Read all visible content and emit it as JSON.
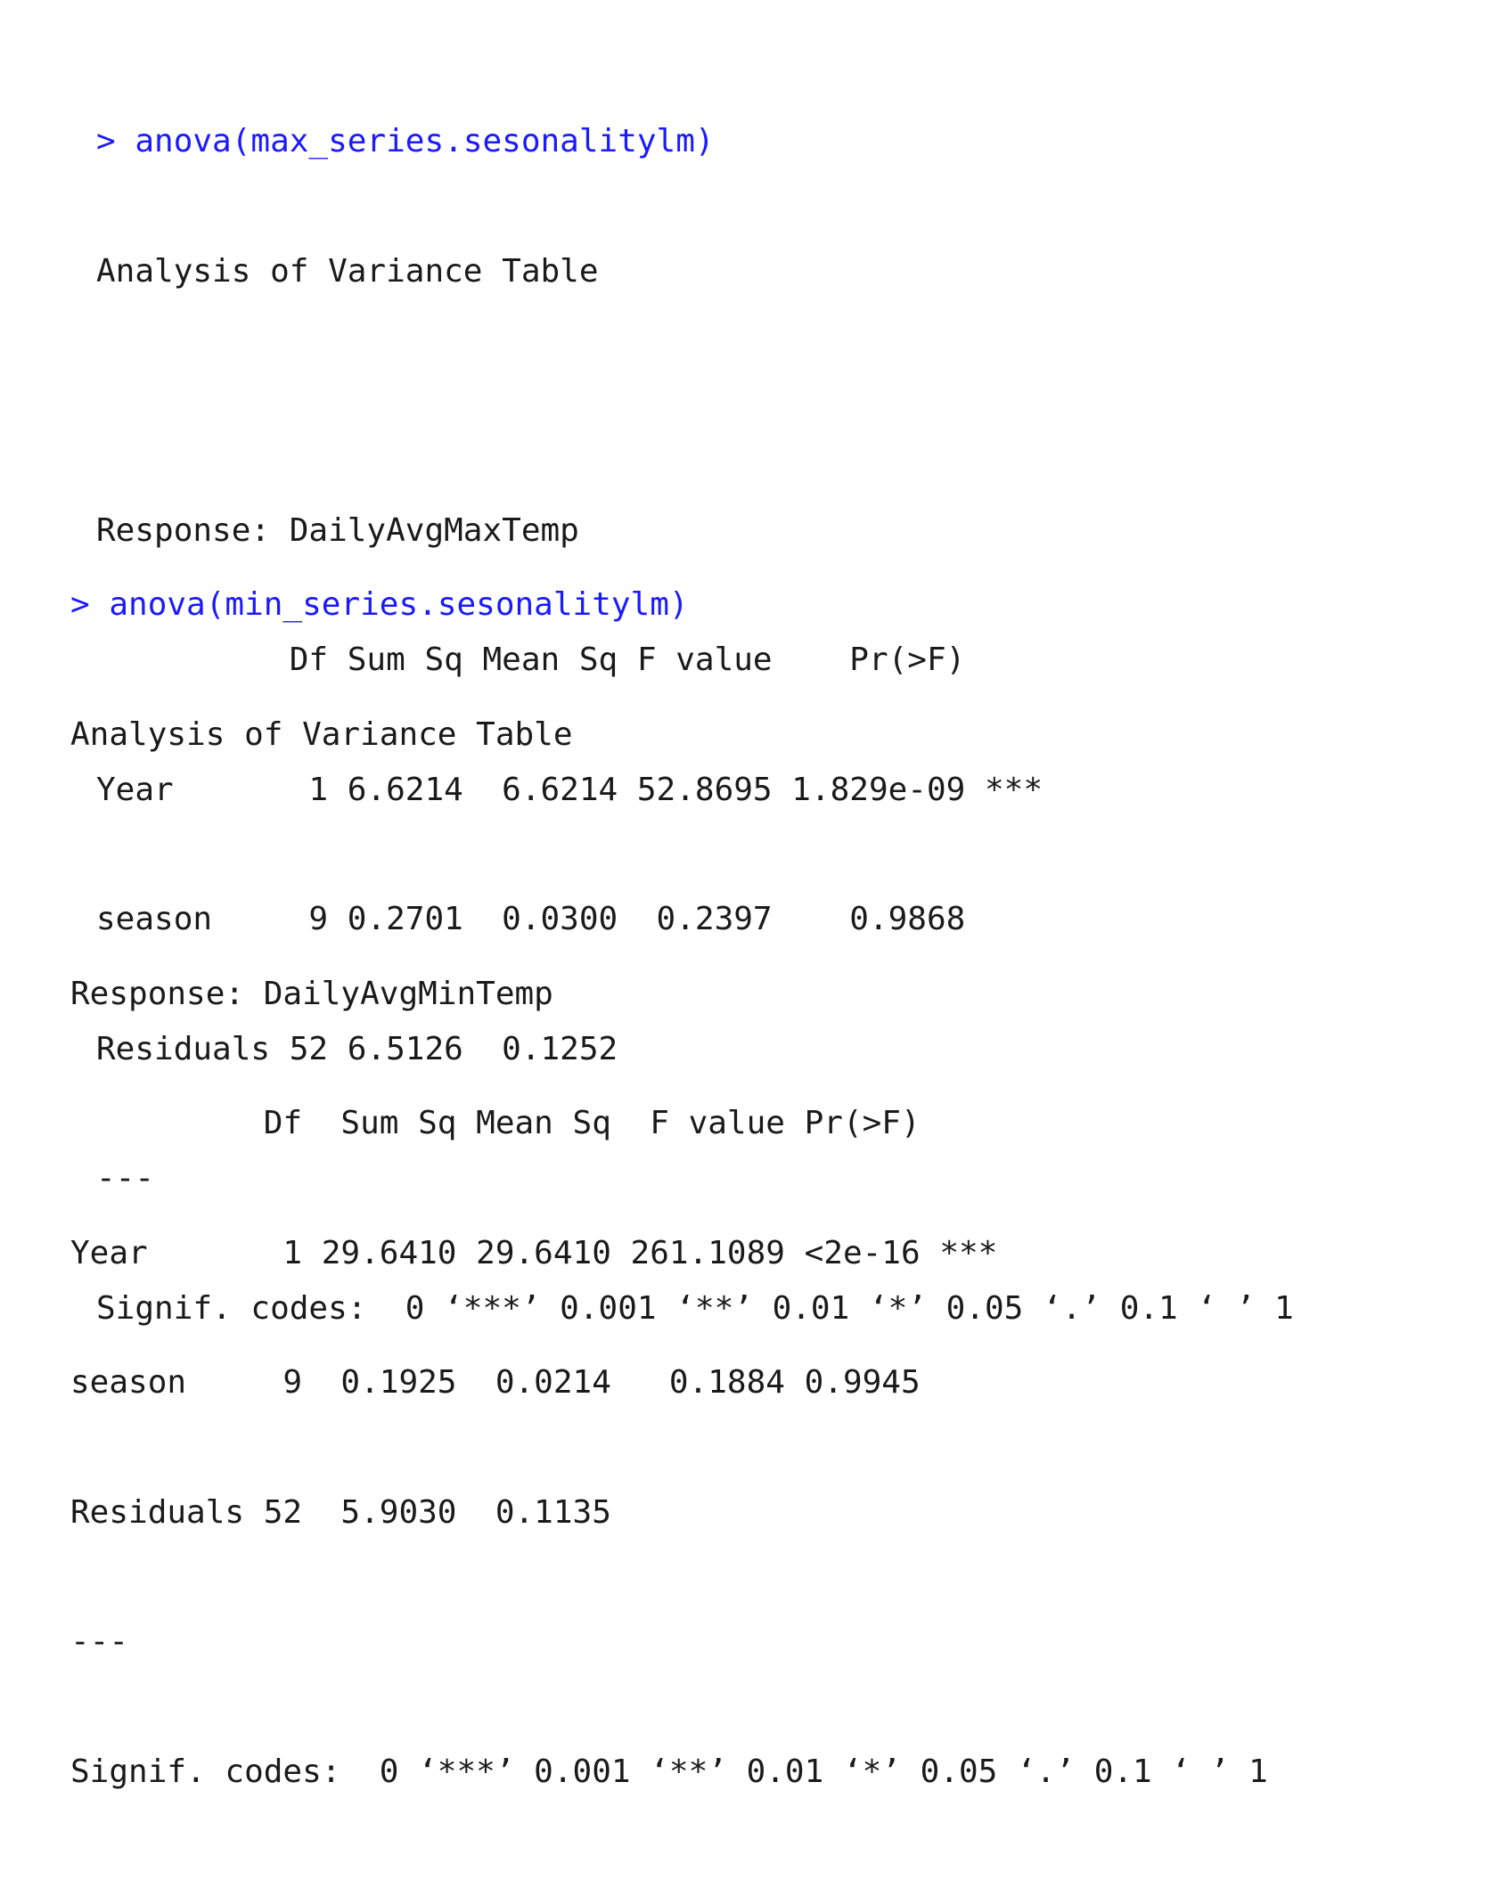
{
  "console": {
    "blocks": [
      {
        "prompt": "> ",
        "command": "anova(max_series.sesonalitylm)",
        "title": "Analysis of Variance Table",
        "response": "Response: DailyAvgMaxTemp",
        "header": "          Df Sum Sq Mean Sq F value    Pr(>F)    ",
        "rows": [
          "Year       1 6.6214  6.6214 52.8695 1.829e-09 ***",
          "season     9 0.2701  0.0300  0.2397    0.9868    ",
          "Residuals 52 6.5126  0.1252                      "
        ],
        "separator": "---",
        "signif": "Signif. codes:  0 ‘***’ 0.001 ‘**’ 0.01 ‘*’ 0.05 ‘.’ 0.1 ‘ ’ 1"
      },
      {
        "prompt": "> ",
        "command": "anova(min_series.sesonalitylm)",
        "title": "Analysis of Variance Table",
        "response": "Response: DailyAvgMinTemp",
        "header": "          Df  Sum Sq Mean Sq  F value Pr(>F)    ",
        "rows": [
          "Year       1 29.6410 29.6410 261.1089 <2e-16 ***",
          "season     9  0.1925  0.0214   0.1884 0.9945    ",
          "Residuals 52  5.9030  0.1135                    "
        ],
        "separator": "---",
        "signif": "Signif. codes:  0 ‘***’ 0.001 ‘**’ 0.01 ‘*’ 0.05 ‘.’ 0.1 ‘ ’ 1"
      }
    ]
  },
  "colors": {
    "command": "#1a1aff",
    "output": "#1a1a1a",
    "background": "#ffffff"
  }
}
